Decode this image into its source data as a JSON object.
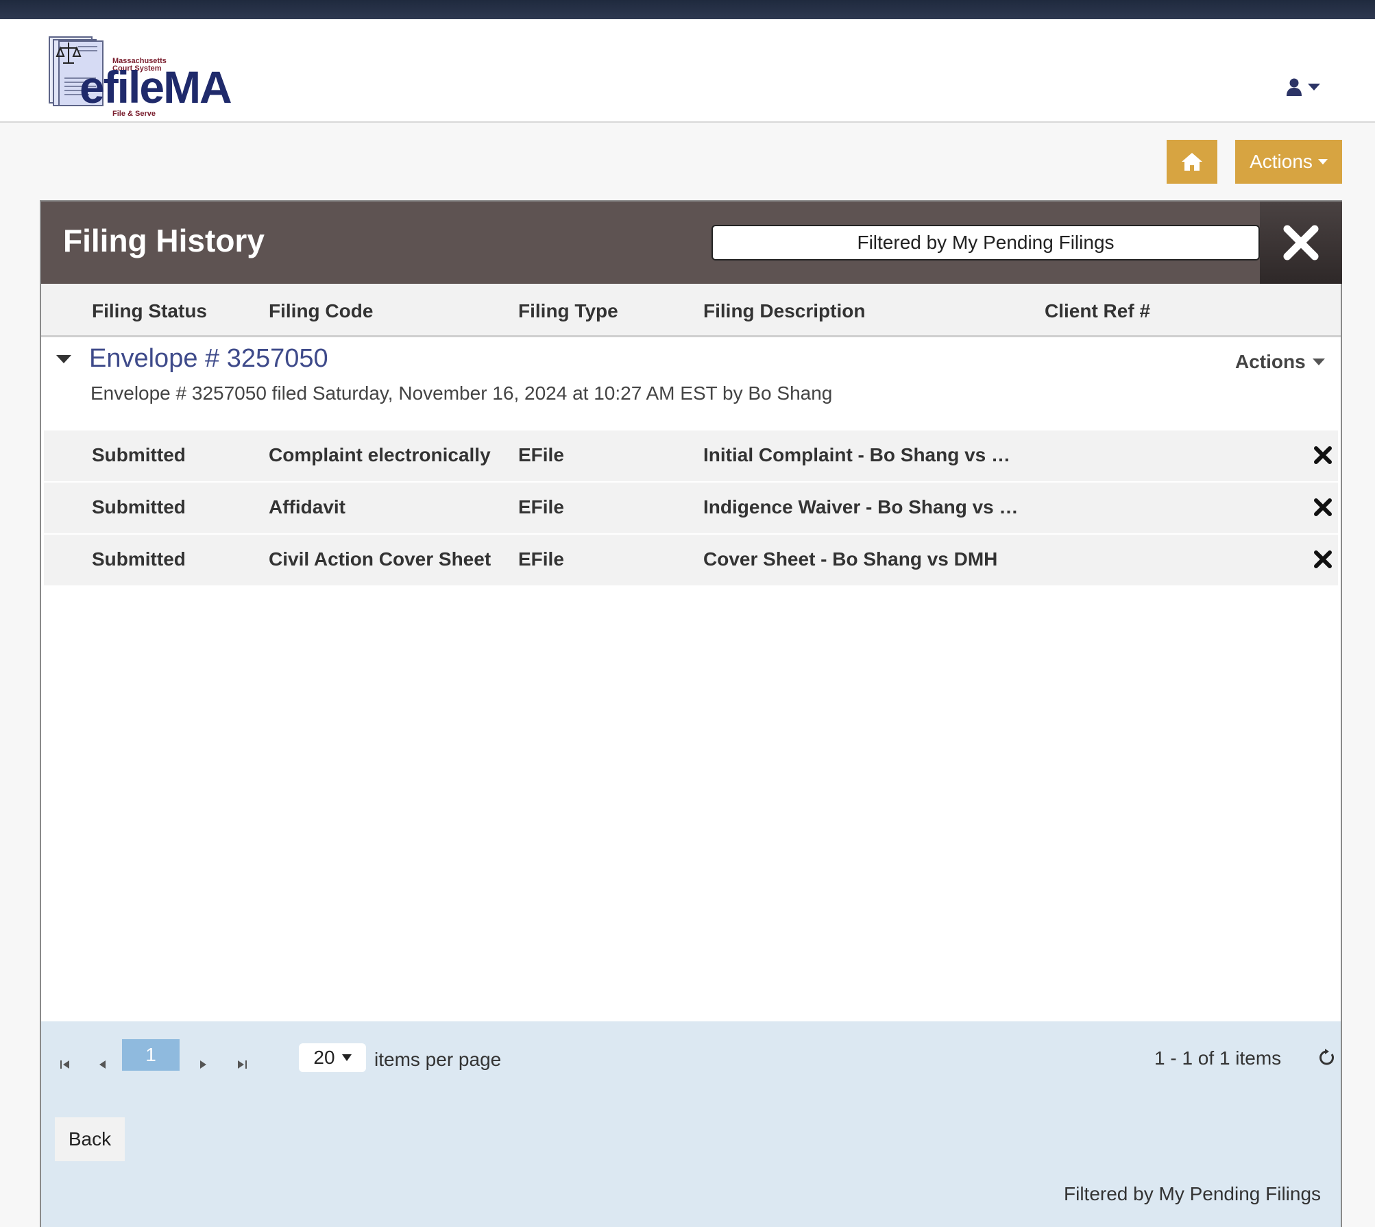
{
  "header": {
    "logo": {
      "line1": "Massachusetts",
      "line2": "Court System",
      "wordmark": "efileMA",
      "tagline": "File & Serve"
    },
    "user_icon": "user-icon"
  },
  "toolbar": {
    "home_icon": "home-icon",
    "actions_label": "Actions"
  },
  "panel": {
    "title": "Filing History",
    "filter_text": "Filtered by My Pending Filings",
    "columns": [
      "Filing Status",
      "Filing Code",
      "Filing Type",
      "Filing Description",
      "Client Ref #"
    ]
  },
  "envelope": {
    "title": "Envelope # 3257050",
    "actions_label": "Actions",
    "subtitle": "Envelope # 3257050 filed Saturday, November 16, 2024 at 10:27 AM EST by Bo Shang",
    "rows": [
      {
        "status": "Submitted",
        "code": "Complaint electronically",
        "type": "EFile",
        "description": "Initial Complaint - Bo Shang vs DMH",
        "client_ref": ""
      },
      {
        "status": "Submitted",
        "code": "Affidavit",
        "type": "EFile",
        "description": "Indigence Waiver - Bo Shang vs DMH",
        "client_ref": ""
      },
      {
        "status": "Submitted",
        "code": "Civil Action Cover Sheet",
        "type": "EFile",
        "description": "Cover Sheet - Bo Shang vs DMH",
        "client_ref": ""
      }
    ]
  },
  "pager": {
    "current_page": "1",
    "page_size": "20",
    "items_per_page_label": "items per page",
    "info": "1 - 1 of 1 items"
  },
  "footer": {
    "back_label": "Back",
    "filter_text": "Filtered by My Pending Filings"
  }
}
